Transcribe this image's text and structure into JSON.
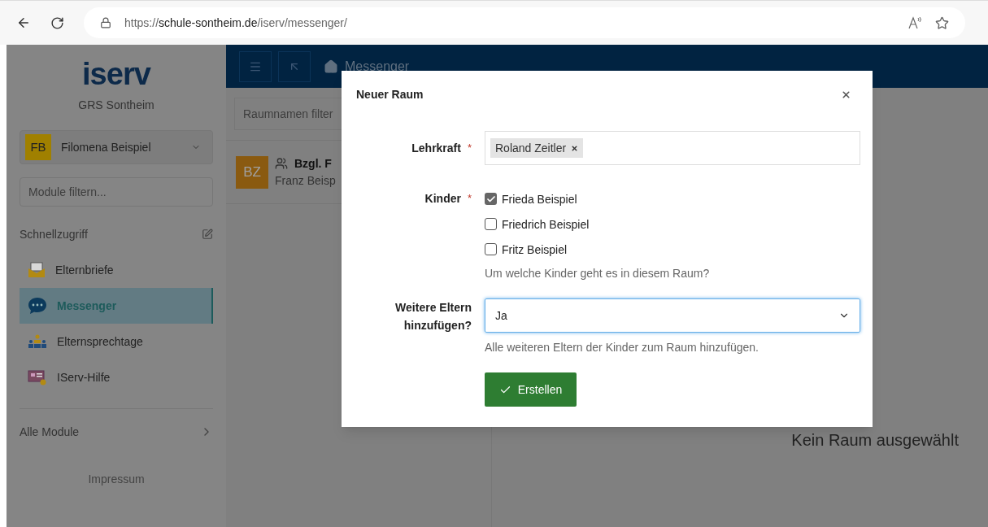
{
  "browser": {
    "url_scheme": "https://",
    "url_host": "schule-sontheim.de",
    "url_path": "/iserv/messenger/"
  },
  "sidebar": {
    "logo": "iserv",
    "school": "GRS Sontheim",
    "user": {
      "initials": "FB",
      "name": "Filomena Beispiel"
    },
    "filter_placeholder": "Module filtern...",
    "quick_access": "Schnellzugriff",
    "items": [
      {
        "kind": "letters",
        "label": "Elternbriefe",
        "selected": false
      },
      {
        "kind": "chat",
        "label": "Messenger",
        "selected": true
      },
      {
        "kind": "people",
        "label": "Elternsprechtage",
        "selected": false
      },
      {
        "kind": "help",
        "label": "IServ-Hilfe",
        "selected": false
      }
    ],
    "all_modules": "Alle Module",
    "imprint": "Impressum"
  },
  "topbar": {
    "breadcrumb": "Messenger"
  },
  "rooms": {
    "filter_placeholder": "Raumnamen filter",
    "items": [
      {
        "initials": "BZ",
        "title": "Bzgl. F",
        "subtitle": "Franz Beisp"
      }
    ]
  },
  "main": {
    "empty": "Kein Raum ausgewählt"
  },
  "dialog": {
    "title": "Neuer Raum",
    "teacher_label": "Lehrkraft",
    "teacher_tags": [
      "Roland Zeitler"
    ],
    "children_label": "Kinder",
    "children": [
      {
        "label": "Frieda Beispiel",
        "checked": true
      },
      {
        "label": "Friedrich Beispiel",
        "checked": false
      },
      {
        "label": "Fritz Beispiel",
        "checked": false
      }
    ],
    "children_help": "Um welche Kinder geht es in diesem Raum?",
    "parents_label": "Weitere Eltern hinzufügen?",
    "parents_value": "Ja",
    "parents_help": "Alle weiteren Eltern der Kinder zum Raum hinzufügen.",
    "submit": "Erstellen",
    "required_mark": "*"
  }
}
